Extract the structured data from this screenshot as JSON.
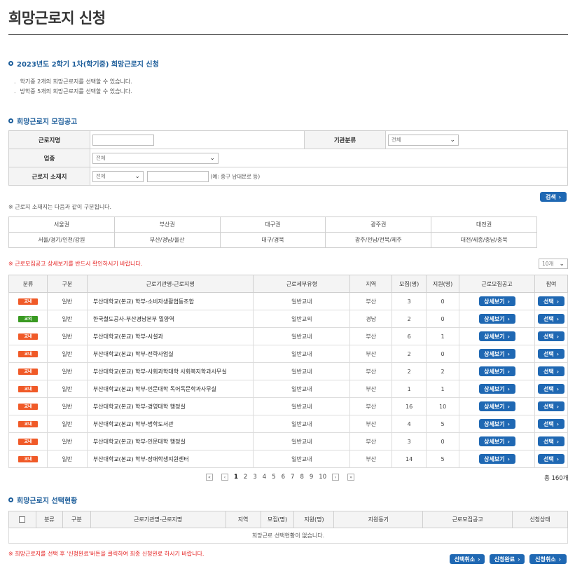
{
  "page": {
    "title": "희망근로지 신청"
  },
  "apply_section": {
    "title": "2023년도 2학기 1차(학기중) 희망근로지 신청",
    "bullets": [
      "학기중 2개의 희망근로지를 선택할 수 있습니다.",
      "방학중 5개의 희망근로지를 선택할 수 있습니다."
    ]
  },
  "recruit_section": {
    "title": "희망근로지 모집공고"
  },
  "search_form": {
    "work_name_label": "근로지명",
    "org_type_label": "기관분류",
    "org_type_value": "전체",
    "industry_label": "업종",
    "industry_value": "전체",
    "location_label": "근로지 소재지",
    "location_value": "전체",
    "location_hint": "(예: 중구 남대문로 등)",
    "search_button": "검색"
  },
  "region_note": "※ 근로지 소재지는 다음과 같이 구분됩니다.",
  "regions": {
    "headers": [
      "서울권",
      "부산권",
      "대구권",
      "광주권",
      "대전권"
    ],
    "details": [
      "서울/경기/인천/강원",
      "부산/경남/울산",
      "대구/경북",
      "광주/전남/전북/제주",
      "대전/세종/충남/충북"
    ]
  },
  "detail_warning": "※ 근로모집공고 상세보기를 반드시 확인하시기 바랍니다.",
  "page_size": "10개",
  "list": {
    "headers": [
      "분류",
      "구분",
      "근로기관명-근로지명",
      "근로세부유형",
      "지역",
      "모집(명)",
      "지원(명)",
      "근로모집공고",
      "참여"
    ],
    "detail_label": "상세보기",
    "select_label": "선택",
    "badge_colors": {
      "교내": "#f05a28",
      "교외": "#3a9a22"
    },
    "rows": [
      {
        "badge": "교내",
        "type": "일반",
        "name": "부산대학교(본교) 학부-소비자생활협동조합",
        "detail": "일반교내",
        "region": "부산",
        "recruit": "3",
        "applied": "0"
      },
      {
        "badge": "교외",
        "type": "일반",
        "name": "한국철도공사-부산경남본부 밀양역",
        "detail": "일반교외",
        "region": "경남",
        "recruit": "2",
        "applied": "0"
      },
      {
        "badge": "교내",
        "type": "일반",
        "name": "부산대학교(본교) 학부-시설과",
        "detail": "일반교내",
        "region": "부산",
        "recruit": "6",
        "applied": "1"
      },
      {
        "badge": "교내",
        "type": "일반",
        "name": "부산대학교(본교) 학부-전략사업실",
        "detail": "일반교내",
        "region": "부산",
        "recruit": "2",
        "applied": "0"
      },
      {
        "badge": "교내",
        "type": "일반",
        "name": "부산대학교(본교) 학부-사회과학대학 사회복지학과사무실",
        "detail": "일반교내",
        "region": "부산",
        "recruit": "2",
        "applied": "2"
      },
      {
        "badge": "교내",
        "type": "일반",
        "name": "부산대학교(본교) 학부-인문대학 독어독문학과사무실",
        "detail": "일반교내",
        "region": "부산",
        "recruit": "1",
        "applied": "1"
      },
      {
        "badge": "교내",
        "type": "일반",
        "name": "부산대학교(본교) 학부-경영대학 행정실",
        "detail": "일반교내",
        "region": "부산",
        "recruit": "16",
        "applied": "10"
      },
      {
        "badge": "교내",
        "type": "일반",
        "name": "부산대학교(본교) 학부-법학도서관",
        "detail": "일반교내",
        "region": "부산",
        "recruit": "4",
        "applied": "5"
      },
      {
        "badge": "교내",
        "type": "일반",
        "name": "부산대학교(본교) 학부-인문대학 행정실",
        "detail": "일반교내",
        "region": "부산",
        "recruit": "3",
        "applied": "0"
      },
      {
        "badge": "교내",
        "type": "일반",
        "name": "부산대학교(본교) 학부-장애학생지원센터",
        "detail": "일반교내",
        "region": "부산",
        "recruit": "14",
        "applied": "5"
      }
    ]
  },
  "pagination": {
    "pages": [
      "1",
      "2",
      "3",
      "4",
      "5",
      "6",
      "7",
      "8",
      "9",
      "10"
    ],
    "current": "1",
    "total": "총 160개"
  },
  "selected_section": {
    "title": "희망근로지 선택현황",
    "headers": [
      "분류",
      "구분",
      "근로기관명-근로지명",
      "지역",
      "모집(명)",
      "지원(명)",
      "지원동기",
      "근로모집공고",
      "신청상태"
    ],
    "empty_message": "희망근로 선택현황이 없습니다.",
    "footer_warning": "※ 희망근로지를 선택 후 '신청완료'버튼을 클릭하여 최종 신청완료 하시기 바랍니다.",
    "buttons": [
      "선택취소",
      "신청완료",
      "신청취소"
    ]
  }
}
